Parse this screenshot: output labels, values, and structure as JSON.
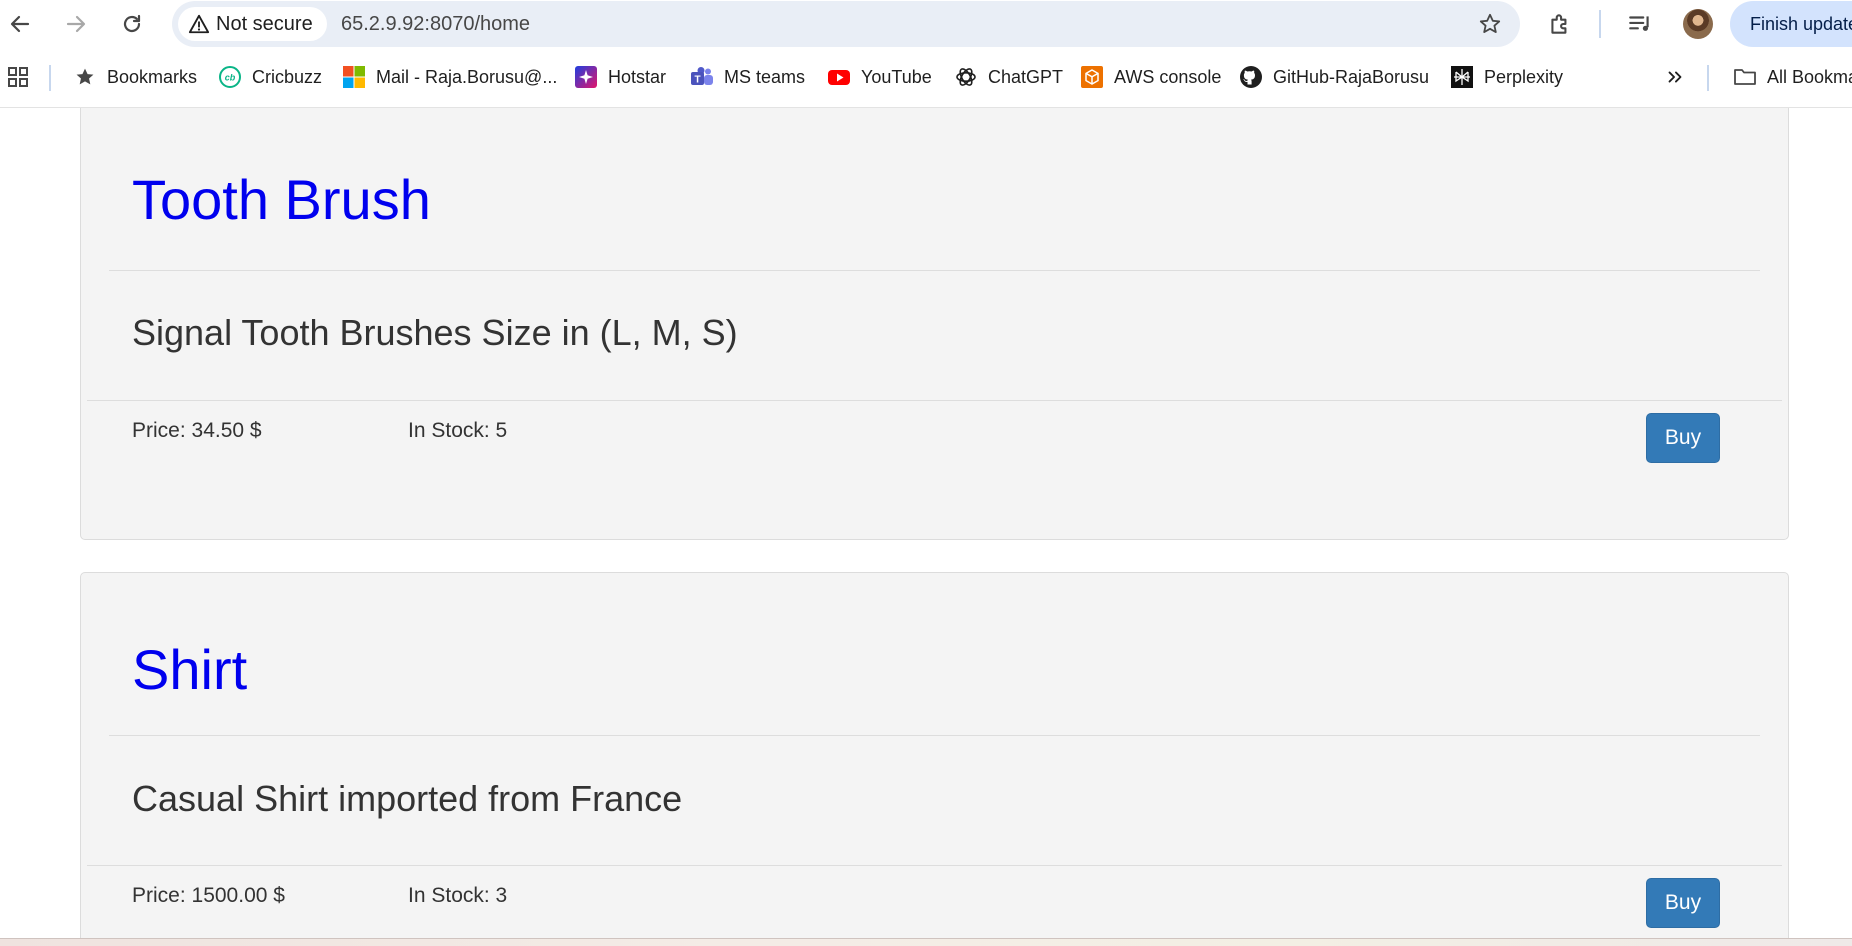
{
  "browser": {
    "security_label": "Not secure",
    "url": "65.2.9.92:8070/home",
    "update_button": "Finish update"
  },
  "bookmarks": {
    "items": [
      {
        "label": "Bookmarks",
        "icon": "star-icon"
      },
      {
        "label": "Cricbuzz",
        "icon": "cricbuzz-icon"
      },
      {
        "label": "Mail - Raja.Borusu@...",
        "icon": "microsoft-icon"
      },
      {
        "label": "Hotstar",
        "icon": "hotstar-icon"
      },
      {
        "label": "MS teams",
        "icon": "teams-icon"
      },
      {
        "label": "YouTube",
        "icon": "youtube-icon"
      },
      {
        "label": "ChatGPT",
        "icon": "chatgpt-icon"
      },
      {
        "label": "AWS console",
        "icon": "aws-icon"
      },
      {
        "label": "GitHub-RajaBorusu",
        "icon": "github-icon"
      },
      {
        "label": "Perplexity",
        "icon": "perplexity-icon"
      }
    ],
    "all_bookmarks": "All Bookmarks"
  },
  "products": [
    {
      "name": "Tooth Brush",
      "description": "Signal Tooth Brushes Size in (L, M, S)",
      "price": "Price: 34.50 $",
      "stock": "In Stock: 5",
      "buy_label": "Buy"
    },
    {
      "name": "Shirt",
      "description": "Casual Shirt imported from France",
      "price": "Price: 1500.00 $",
      "stock": "In Stock: 3",
      "buy_label": "Buy"
    }
  ]
}
